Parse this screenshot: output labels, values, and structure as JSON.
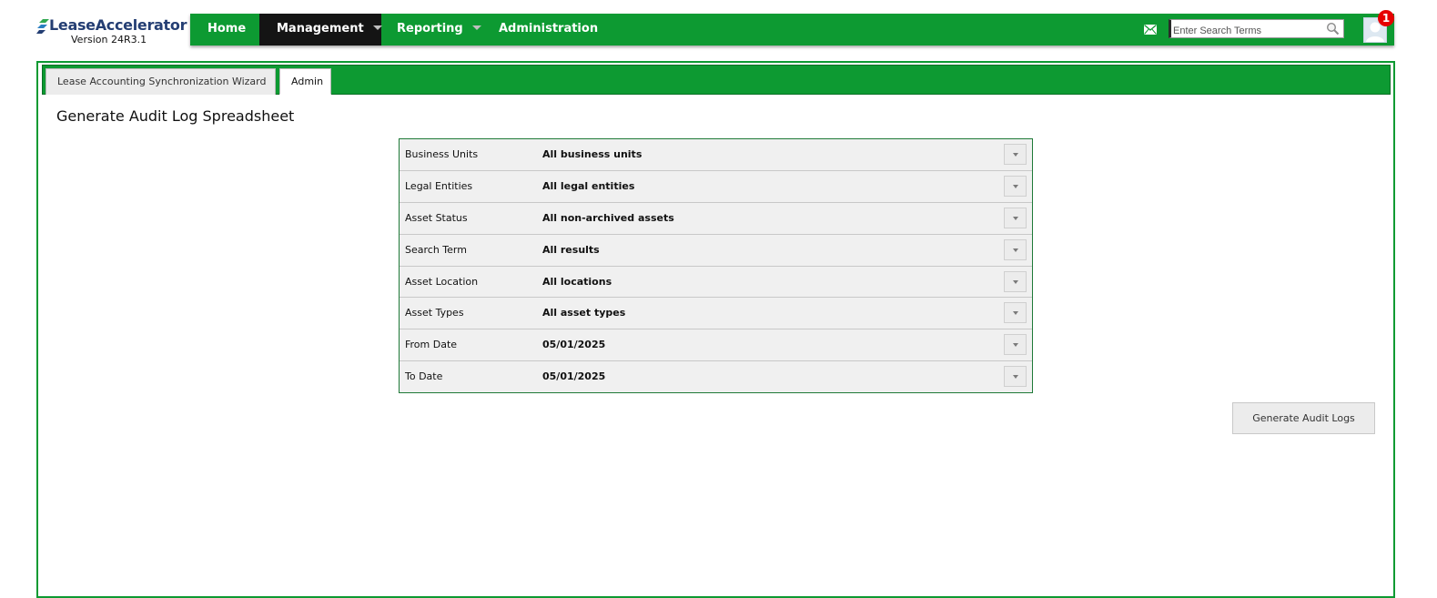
{
  "logo": {
    "text": "LeaseAccelerator",
    "version": "Version 24R3.1"
  },
  "nav": {
    "items": [
      {
        "label": "Home",
        "has_caret": false,
        "active": false
      },
      {
        "label": "Management",
        "has_caret": true,
        "active": true
      },
      {
        "label": "Reporting",
        "has_caret": true,
        "active": false
      },
      {
        "label": "Administration",
        "has_caret": false,
        "active": false
      }
    ],
    "search_placeholder": "Enter Search Terms",
    "notification_count": "1"
  },
  "tabs": [
    {
      "label": "Lease Accounting Synchronization Wizard",
      "active": false
    },
    {
      "label": "Admin",
      "active": true
    }
  ],
  "page": {
    "title": "Generate Audit Log Spreadsheet",
    "filters": [
      {
        "label": "Business Units",
        "value": "All business units"
      },
      {
        "label": "Legal Entities",
        "value": "All legal entities"
      },
      {
        "label": "Asset Status",
        "value": "All non-archived assets"
      },
      {
        "label": "Search Term",
        "value": "All results"
      },
      {
        "label": "Asset Location",
        "value": "All locations"
      },
      {
        "label": "Asset Types",
        "value": "All asset types"
      },
      {
        "label": "From Date",
        "value": "05/01/2025"
      },
      {
        "label": "To Date",
        "value": "05/01/2025"
      }
    ],
    "generate_button": "Generate Audit Logs"
  },
  "colors": {
    "nav_green": "#0d9a32",
    "active_nav": "#141414",
    "badge_red": "#e60000",
    "logo_blue": "#243e73"
  }
}
